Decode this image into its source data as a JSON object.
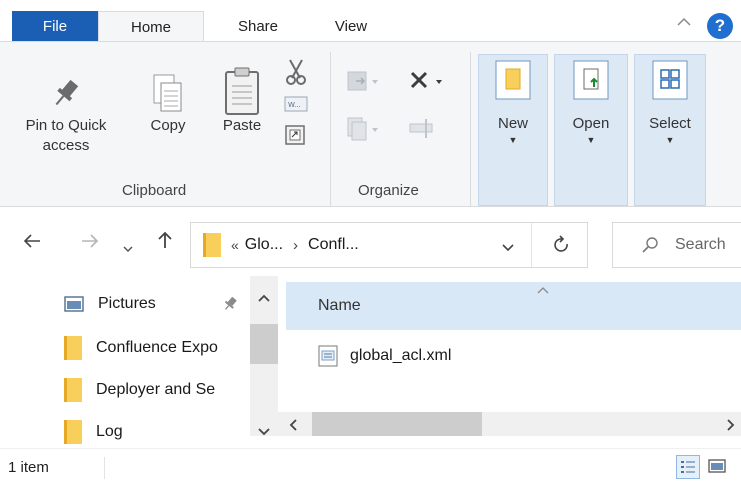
{
  "tabs": {
    "file": "File",
    "home": "Home",
    "share": "Share",
    "view": "View"
  },
  "ribbon": {
    "clipboard": {
      "pin_label_line1": "Pin to Quick",
      "pin_label_line2": "access",
      "copy_label": "Copy",
      "paste_label": "Paste",
      "group_label": "Clipboard"
    },
    "organize": {
      "group_label": "Organize"
    },
    "new_label": "New",
    "open_label": "Open",
    "select_label": "Select"
  },
  "address": {
    "overflow": "«",
    "crumb1": "Glo...",
    "sep": "›",
    "crumb2": "Confl...",
    "search_placeholder": "Search"
  },
  "navpane": {
    "items": [
      {
        "label": "Pictures"
      },
      {
        "label": "Confluence Expo"
      },
      {
        "label": "Deployer and Se"
      },
      {
        "label": "Log"
      }
    ]
  },
  "filelist": {
    "column_name": "Name",
    "files": [
      {
        "name": "global_acl.xml"
      }
    ]
  },
  "status": {
    "count": "1 item"
  },
  "colors": {
    "accent": "#1a5fb4",
    "selected_bg": "#dde8f5",
    "header_bg": "#d9e8f7",
    "folder": "#f7cf5a"
  },
  "icons": {
    "pin": "pin-icon",
    "copy": "copy-icon",
    "paste": "paste-icon",
    "cut": "scissors-icon",
    "help": "help-icon",
    "refresh": "refresh-icon",
    "search": "search-icon"
  }
}
